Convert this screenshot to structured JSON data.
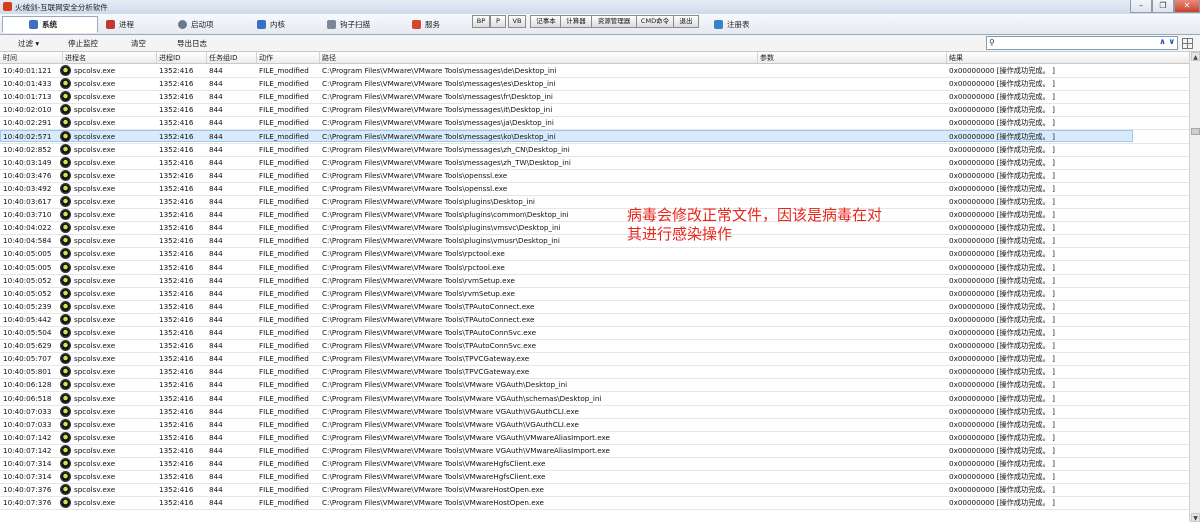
{
  "window": {
    "title": "火绒剑-互联网安全分析软件",
    "minimize": "–",
    "restore": "❐",
    "close": "✕"
  },
  "tabs": [
    {
      "label": "系统",
      "icon": "monitor-icon",
      "color": "#3f6fbf",
      "active": true
    },
    {
      "label": "进程",
      "icon": "process-icon",
      "color": "#c0392b"
    },
    {
      "label": "启动项",
      "icon": "startup-icon",
      "color": "#6a7a8c"
    },
    {
      "label": "内核",
      "icon": "kernel-icon",
      "color": "#3b6fc4"
    },
    {
      "label": "钩子扫描",
      "icon": "hook-icon",
      "color": "#7c8796"
    },
    {
      "label": "服务",
      "icon": "service-icon",
      "color": "#d6452e"
    }
  ],
  "quick_buttons": [
    "BP",
    "P",
    "VB",
    "记事本",
    "计算器",
    "资源管理器",
    "CMD命令",
    "退出"
  ],
  "registry_tab": {
    "label": "注册表",
    "icon": "registry-icon"
  },
  "toolbar": {
    "filter": "过滤 ▾",
    "stop_monitor": "停止监控",
    "clear": "清空",
    "export_log": "导出日志"
  },
  "columns": [
    "时间",
    "进程名",
    "进程ID",
    "任务组ID",
    "动作",
    "路径",
    "参数",
    "结果"
  ],
  "rows": [
    {
      "time": "10:40:01:121",
      "proc": "spcolsv.exe",
      "pid": "1352:416",
      "tg": "844",
      "action": "FILE_modified",
      "path": "C:\\Program Files\\VMware\\VMware Tools\\messages\\de\\Desktop_ini",
      "param": "",
      "result": "0x00000000 [操作成功完成。 ]"
    },
    {
      "time": "10:40:01:433",
      "proc": "spcolsv.exe",
      "pid": "1352:416",
      "tg": "844",
      "action": "FILE_modified",
      "path": "C:\\Program Files\\VMware\\VMware Tools\\messages\\es\\Desktop_ini",
      "param": "",
      "result": "0x00000000 [操作成功完成。 ]"
    },
    {
      "time": "10:40:01:713",
      "proc": "spcolsv.exe",
      "pid": "1352:416",
      "tg": "844",
      "action": "FILE_modified",
      "path": "C:\\Program Files\\VMware\\VMware Tools\\messages\\fr\\Desktop_ini",
      "param": "",
      "result": "0x00000000 [操作成功完成。 ]"
    },
    {
      "time": "10:40:02:010",
      "proc": "spcolsv.exe",
      "pid": "1352:416",
      "tg": "844",
      "action": "FILE_modified",
      "path": "C:\\Program Files\\VMware\\VMware Tools\\messages\\it\\Desktop_ini",
      "param": "",
      "result": "0x00000000 [操作成功完成。 ]"
    },
    {
      "time": "10:40:02:291",
      "proc": "spcolsv.exe",
      "pid": "1352:416",
      "tg": "844",
      "action": "FILE_modified",
      "path": "C:\\Program Files\\VMware\\VMware Tools\\messages\\ja\\Desktop_ini",
      "param": "",
      "result": "0x00000000 [操作成功完成。 ]"
    },
    {
      "time": "10:40:02:571",
      "proc": "spcolsv.exe",
      "pid": "1352:416",
      "tg": "844",
      "action": "FILE_modified",
      "path": "C:\\Program Files\\VMware\\VMware Tools\\messages\\ko\\Desktop_ini",
      "param": "",
      "result": "0x00000000 [操作成功完成。 ]",
      "selected": true
    },
    {
      "time": "10:40:02:852",
      "proc": "spcolsv.exe",
      "pid": "1352:416",
      "tg": "844",
      "action": "FILE_modified",
      "path": "C:\\Program Files\\VMware\\VMware Tools\\messages\\zh_CN\\Desktop_ini",
      "param": "",
      "result": "0x00000000 [操作成功完成。 ]"
    },
    {
      "time": "10:40:03:149",
      "proc": "spcolsv.exe",
      "pid": "1352:416",
      "tg": "844",
      "action": "FILE_modified",
      "path": "C:\\Program Files\\VMware\\VMware Tools\\messages\\zh_TW\\Desktop_ini",
      "param": "",
      "result": "0x00000000 [操作成功完成。 ]"
    },
    {
      "time": "10:40:03:476",
      "proc": "spcolsv.exe",
      "pid": "1352:416",
      "tg": "844",
      "action": "FILE_modified",
      "path": "C:\\Program Files\\VMware\\VMware Tools\\openssl.exe",
      "param": "",
      "result": "0x00000000 [操作成功完成。 ]"
    },
    {
      "time": "10:40:03:492",
      "proc": "spcolsv.exe",
      "pid": "1352:416",
      "tg": "844",
      "action": "FILE_modified",
      "path": "C:\\Program Files\\VMware\\VMware Tools\\openssl.exe",
      "param": "",
      "result": "0x00000000 [操作成功完成。 ]"
    },
    {
      "time": "10:40:03:617",
      "proc": "spcolsv.exe",
      "pid": "1352:416",
      "tg": "844",
      "action": "FILE_modified",
      "path": "C:\\Program Files\\VMware\\VMware Tools\\plugins\\Desktop_ini",
      "param": "",
      "result": "0x00000000 [操作成功完成。 ]"
    },
    {
      "time": "10:40:03:710",
      "proc": "spcolsv.exe",
      "pid": "1352:416",
      "tg": "844",
      "action": "FILE_modified",
      "path": "C:\\Program Files\\VMware\\VMware Tools\\plugins\\common\\Desktop_ini",
      "param": "",
      "result": "0x00000000 [操作成功完成。 ]"
    },
    {
      "time": "10:40:04:022",
      "proc": "spcolsv.exe",
      "pid": "1352:416",
      "tg": "844",
      "action": "FILE_modified",
      "path": "C:\\Program Files\\VMware\\VMware Tools\\plugins\\vmsvc\\Desktop_ini",
      "param": "",
      "result": "0x00000000 [操作成功完成。 ]"
    },
    {
      "time": "10:40:04:584",
      "proc": "spcolsv.exe",
      "pid": "1352:416",
      "tg": "844",
      "action": "FILE_modified",
      "path": "C:\\Program Files\\VMware\\VMware Tools\\plugins\\vmusr\\Desktop_ini",
      "param": "",
      "result": "0x00000000 [操作成功完成。 ]"
    },
    {
      "time": "10:40:05:005",
      "proc": "spcolsv.exe",
      "pid": "1352:416",
      "tg": "844",
      "action": "FILE_modified",
      "path": "C:\\Program Files\\VMware\\VMware Tools\\rpctool.exe",
      "param": "",
      "result": "0x00000000 [操作成功完成。 ]"
    },
    {
      "time": "10:40:05:005",
      "proc": "spcolsv.exe",
      "pid": "1352:416",
      "tg": "844",
      "action": "FILE_modified",
      "path": "C:\\Program Files\\VMware\\VMware Tools\\rpctool.exe",
      "param": "",
      "result": "0x00000000 [操作成功完成。 ]"
    },
    {
      "time": "10:40:05:052",
      "proc": "spcolsv.exe",
      "pid": "1352:416",
      "tg": "844",
      "action": "FILE_modified",
      "path": "C:\\Program Files\\VMware\\VMware Tools\\rvmSetup.exe",
      "param": "",
      "result": "0x00000000 [操作成功完成。 ]"
    },
    {
      "time": "10:40:05:052",
      "proc": "spcolsv.exe",
      "pid": "1352:416",
      "tg": "844",
      "action": "FILE_modified",
      "path": "C:\\Program Files\\VMware\\VMware Tools\\rvmSetup.exe",
      "param": "",
      "result": "0x00000000 [操作成功完成。 ]"
    },
    {
      "time": "10:40:05:239",
      "proc": "spcolsv.exe",
      "pid": "1352:416",
      "tg": "844",
      "action": "FILE_modified",
      "path": "C:\\Program Files\\VMware\\VMware Tools\\TPAutoConnect.exe",
      "param": "",
      "result": "0x00000000 [操作成功完成。 ]"
    },
    {
      "time": "10:40:05:442",
      "proc": "spcolsv.exe",
      "pid": "1352:416",
      "tg": "844",
      "action": "FILE_modified",
      "path": "C:\\Program Files\\VMware\\VMware Tools\\TPAutoConnect.exe",
      "param": "",
      "result": "0x00000000 [操作成功完成。 ]"
    },
    {
      "time": "10:40:05:504",
      "proc": "spcolsv.exe",
      "pid": "1352:416",
      "tg": "844",
      "action": "FILE_modified",
      "path": "C:\\Program Files\\VMware\\VMware Tools\\TPAutoConnSvc.exe",
      "param": "",
      "result": "0x00000000 [操作成功完成。 ]"
    },
    {
      "time": "10:40:05:629",
      "proc": "spcolsv.exe",
      "pid": "1352:416",
      "tg": "844",
      "action": "FILE_modified",
      "path": "C:\\Program Files\\VMware\\VMware Tools\\TPAutoConnSvc.exe",
      "param": "",
      "result": "0x00000000 [操作成功完成。 ]"
    },
    {
      "time": "10:40:05:707",
      "proc": "spcolsv.exe",
      "pid": "1352:416",
      "tg": "844",
      "action": "FILE_modified",
      "path": "C:\\Program Files\\VMware\\VMware Tools\\TPVCGateway.exe",
      "param": "",
      "result": "0x00000000 [操作成功完成。 ]"
    },
    {
      "time": "10:40:05:801",
      "proc": "spcolsv.exe",
      "pid": "1352:416",
      "tg": "844",
      "action": "FILE_modified",
      "path": "C:\\Program Files\\VMware\\VMware Tools\\TPVCGateway.exe",
      "param": "",
      "result": "0x00000000 [操作成功完成。 ]"
    },
    {
      "time": "10:40:06:128",
      "proc": "spcolsv.exe",
      "pid": "1352:416",
      "tg": "844",
      "action": "FILE_modified",
      "path": "C:\\Program Files\\VMware\\VMware Tools\\VMware VGAuth\\Desktop_ini",
      "param": "",
      "result": "0x00000000 [操作成功完成。 ]"
    },
    {
      "time": "10:40:06:518",
      "proc": "spcolsv.exe",
      "pid": "1352:416",
      "tg": "844",
      "action": "FILE_modified",
      "path": "C:\\Program Files\\VMware\\VMware Tools\\VMware VGAuth\\schemas\\Desktop_ini",
      "param": "",
      "result": "0x00000000 [操作成功完成。 ]"
    },
    {
      "time": "10:40:07:033",
      "proc": "spcolsv.exe",
      "pid": "1352:416",
      "tg": "844",
      "action": "FILE_modified",
      "path": "C:\\Program Files\\VMware\\VMware Tools\\VMware VGAuth\\VGAuthCLI.exe",
      "param": "",
      "result": "0x00000000 [操作成功完成。 ]"
    },
    {
      "time": "10:40:07:033",
      "proc": "spcolsv.exe",
      "pid": "1352:416",
      "tg": "844",
      "action": "FILE_modified",
      "path": "C:\\Program Files\\VMware\\VMware Tools\\VMware VGAuth\\VGAuthCLI.exe",
      "param": "",
      "result": "0x00000000 [操作成功完成。 ]"
    },
    {
      "time": "10:40:07:142",
      "proc": "spcolsv.exe",
      "pid": "1352:416",
      "tg": "844",
      "action": "FILE_modified",
      "path": "C:\\Program Files\\VMware\\VMware Tools\\VMware VGAuth\\VMwareAliasImport.exe",
      "param": "",
      "result": "0x00000000 [操作成功完成。 ]"
    },
    {
      "time": "10:40:07:142",
      "proc": "spcolsv.exe",
      "pid": "1352:416",
      "tg": "844",
      "action": "FILE_modified",
      "path": "C:\\Program Files\\VMware\\VMware Tools\\VMware VGAuth\\VMwareAliasImport.exe",
      "param": "",
      "result": "0x00000000 [操作成功完成。 ]"
    },
    {
      "time": "10:40:07:314",
      "proc": "spcolsv.exe",
      "pid": "1352:416",
      "tg": "844",
      "action": "FILE_modified",
      "path": "C:\\Program Files\\VMware\\VMware Tools\\VMwareHgfsClient.exe",
      "param": "",
      "result": "0x00000000 [操作成功完成。 ]"
    },
    {
      "time": "10:40:07:314",
      "proc": "spcolsv.exe",
      "pid": "1352:416",
      "tg": "844",
      "action": "FILE_modified",
      "path": "C:\\Program Files\\VMware\\VMware Tools\\VMwareHgfsClient.exe",
      "param": "",
      "result": "0x00000000 [操作成功完成。 ]"
    },
    {
      "time": "10:40:07:376",
      "proc": "spcolsv.exe",
      "pid": "1352:416",
      "tg": "844",
      "action": "FILE_modified",
      "path": "C:\\Program Files\\VMware\\VMware Tools\\VMwareHostOpen.exe",
      "param": "",
      "result": "0x00000000 [操作成功完成。 ]"
    },
    {
      "time": "10:40:07:376",
      "proc": "spcolsv.exe",
      "pid": "1352:416",
      "tg": "844",
      "action": "FILE_modified",
      "path": "C:\\Program Files\\VMware\\VMware Tools\\VMwareHostOpen.exe",
      "param": "",
      "result": "0x00000000 [操作成功完成。 ]"
    }
  ],
  "annotation": {
    "line1": "病毒会修改正常文件，因该是病毒在对",
    "line2": "其进行感染操作",
    "color": "#e8261c"
  },
  "colors": {
    "selected_row": "#d9ebfb",
    "accent": "#1f4fb5"
  }
}
